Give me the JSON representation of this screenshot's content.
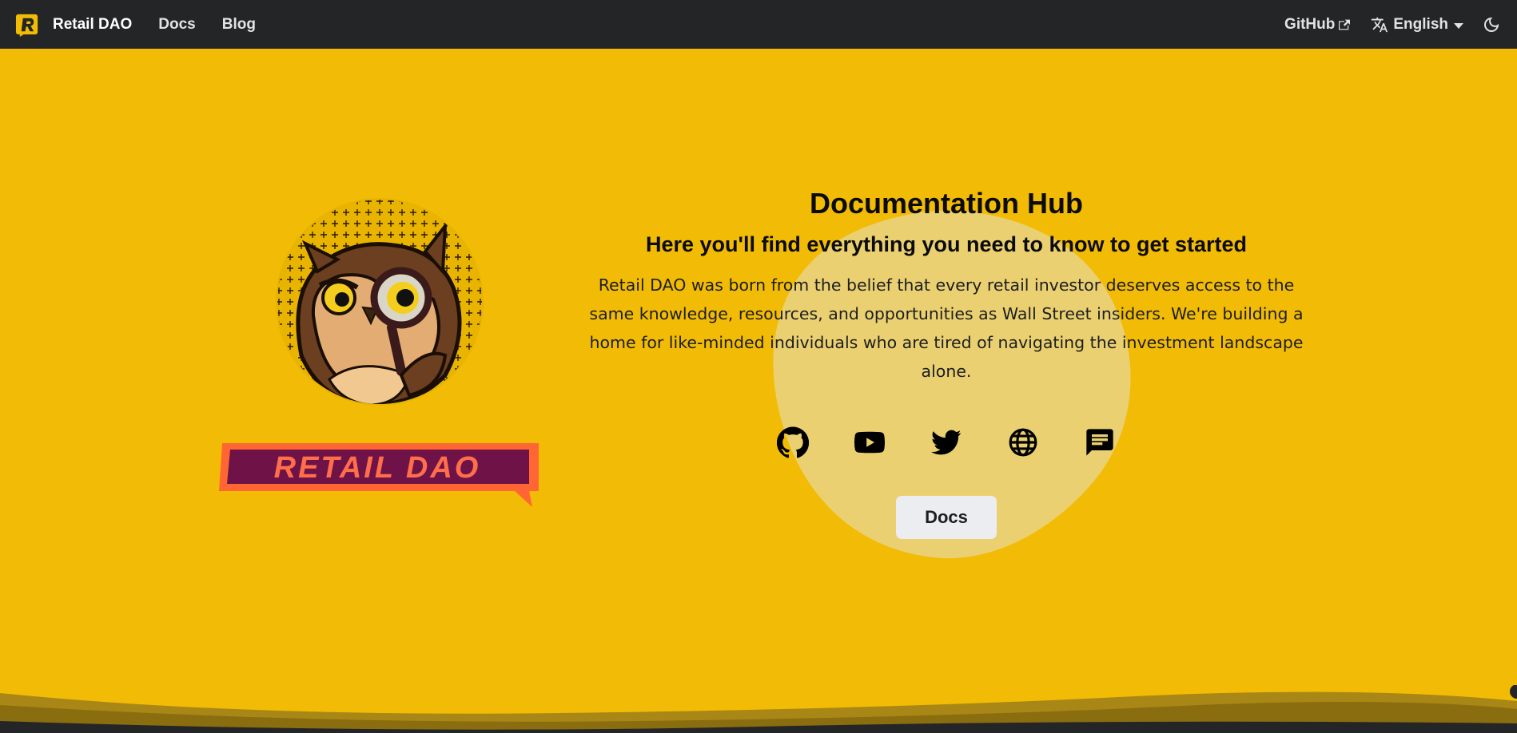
{
  "navbar": {
    "brand_title": "Retail DAO",
    "links": [
      "Docs",
      "Blog"
    ],
    "github_label": "GitHub",
    "language_label": "English",
    "icons": {
      "external": "external-link-icon",
      "language": "translate-icon",
      "theme": "moon-icon"
    }
  },
  "hero": {
    "title": "Documentation Hub",
    "subtitle": "Here you'll find everything you need to know to get started",
    "description": "Retail DAO was born from the belief that every retail investor deserves access to the same knowledge, resources, and opportunities as Wall Street insiders. We're building a home for like-minded individuals who are tired of navigating the investment landscape alone.",
    "wordmark_text": "RETAIL DAO",
    "social_icons": [
      "github-icon",
      "youtube-icon",
      "twitter-icon",
      "globe-icon",
      "chat-icon"
    ],
    "cta_label": "Docs"
  },
  "colors": {
    "background": "#f2bb05",
    "navbar": "#242526",
    "blob": "#ead070",
    "button": "#ebedf0",
    "wordmark_fill": "#ff6633",
    "wordmark_inner": "#6e1248"
  }
}
